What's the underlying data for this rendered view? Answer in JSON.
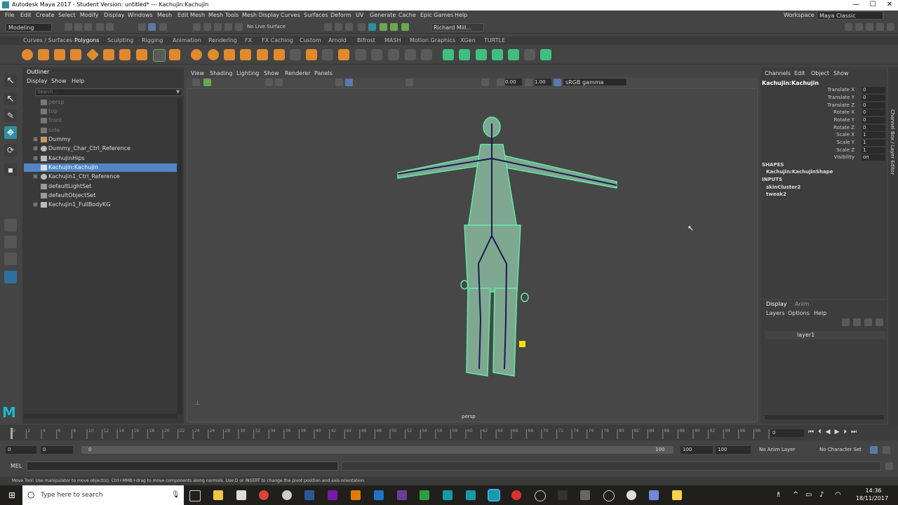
{
  "window": {
    "title": "Autodesk Maya 2017 - Student Version: untitled*   ---   Kachujin:Kachujin",
    "min": "—",
    "max": "☐",
    "close": "✕"
  },
  "menu": [
    "File",
    "Edit",
    "Create",
    "Select",
    "Modify",
    "Display",
    "Windows",
    "Mesh",
    "Edit Mesh",
    "Mesh Tools",
    "Mesh Display",
    "Curves",
    "Surfaces",
    "Deform",
    "UV",
    "Generate",
    "Cache",
    "Epic Games",
    "Help"
  ],
  "workspace": {
    "label": "Workspace :",
    "value": "Maya Classic"
  },
  "status": {
    "mode": "Modeling",
    "live_surface": "No Live Surface",
    "user": "Richard Mill..."
  },
  "shelf_tabs": [
    "Curves / Surfaces",
    "Polygons",
    "Sculpting",
    "Rigging",
    "Animation",
    "Rendering",
    "FX",
    "FX Caching",
    "Custom",
    "Arnold",
    "Bifrost",
    "MASH",
    "Motion Graphics",
    "XGen",
    "TURTLE"
  ],
  "outliner": {
    "title": "Outliner",
    "menu": [
      "Display",
      "Show",
      "Help"
    ],
    "search_placeholder": "Search...",
    "items": [
      {
        "label": "persp",
        "dim": true
      },
      {
        "label": "top",
        "dim": true
      },
      {
        "label": "front",
        "dim": true
      },
      {
        "label": "side",
        "dim": true
      },
      {
        "label": "Dummy",
        "plus": "⊞"
      },
      {
        "label": "Dummy_Char_Ctrl_Reference",
        "plus": "⊞"
      },
      {
        "label": "KachujinHips",
        "plus": "⊞"
      },
      {
        "label": "Kachujin:Kachujin",
        "selected": true
      },
      {
        "label": "Kachujin1_Ctrl_Reference",
        "plus": "⊞"
      },
      {
        "label": "defaultLightSet"
      },
      {
        "label": "defaultObjectSet"
      },
      {
        "label": "Kachujin1_FullBodyKG",
        "plus": "⊞"
      }
    ]
  },
  "viewport": {
    "menu": [
      "View",
      "Shading",
      "Lighting",
      "Show",
      "Renderer",
      "Panels"
    ],
    "field1": "0.00",
    "field2": "1.00",
    "colorspace": "sRGB gamma",
    "camera": "persp"
  },
  "channel_box": {
    "menu": [
      "Channels",
      "Edit",
      "Object",
      "Show"
    ],
    "object": "Kachujin:Kachujin",
    "attrs": [
      {
        "name": "Translate X",
        "value": "0"
      },
      {
        "name": "Translate Y",
        "value": "0"
      },
      {
        "name": "Translate Z",
        "value": "0"
      },
      {
        "name": "Rotate X",
        "value": "0"
      },
      {
        "name": "Rotate Y",
        "value": "0"
      },
      {
        "name": "Rotate Z",
        "value": "0"
      },
      {
        "name": "Scale X",
        "value": "1"
      },
      {
        "name": "Scale Y",
        "value": "1"
      },
      {
        "name": "Scale Z",
        "value": "1"
      },
      {
        "name": "Visibility",
        "value": "on"
      }
    ],
    "shapes_header": "SHAPES",
    "shape": "Kachujin:KachujinShape",
    "inputs_header": "INPUTS",
    "inputs": [
      "skinCluster2",
      "tweak2"
    ]
  },
  "layer_editor": {
    "tabs": [
      "Display",
      "Anim"
    ],
    "menu": [
      "Layers",
      "Options",
      "Help"
    ],
    "layer": "layer1"
  },
  "side_tabs": [
    "Channel Box / Layer Editor"
  ],
  "time": {
    "ticks": [
      "0",
      "2",
      "4",
      "6",
      "8",
      "10",
      "12",
      "14",
      "16",
      "18",
      "20",
      "22",
      "24",
      "26",
      "28",
      "30",
      "32",
      "34",
      "36",
      "38",
      "40",
      "42",
      "44",
      "46",
      "48",
      "50",
      "52",
      "54",
      "56",
      "58",
      "60",
      "62",
      "64",
      "66",
      "68",
      "70",
      "72",
      "74",
      "76",
      "78",
      "80",
      "82",
      "84",
      "86",
      "88",
      "90",
      "92",
      "94",
      "96",
      "98",
      "100"
    ],
    "current": "0",
    "start": "0",
    "range_start": "0",
    "range_thumb": "0",
    "range_thumb_end": "100",
    "range_end": "100",
    "end": "100",
    "anim_layer": "No Anim Layer",
    "char_set": "No Character Set"
  },
  "command": {
    "lang": "MEL"
  },
  "help_line": "Move Tool: Use manipulator to move object(s). Ctrl+MMB+drag to move components along normals. Use D or INSERT to change the pivot position and axis orientation.",
  "taskbar": {
    "search": "Type here to search",
    "time": "14:36",
    "date": "18/11/2017"
  }
}
